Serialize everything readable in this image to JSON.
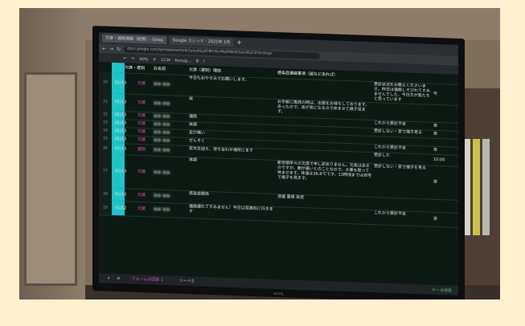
{
  "browser": {
    "tabs": [
      "文章・連絡連絡（総務）- Goog",
      "Google スレッド - 2021年 1月"
    ],
    "new_tab": "+",
    "url": "docs.google.com/spreadsheets/d/1unuA2yBTBYr8yrMqRNEdG5znXEiZ3FDn5hqV"
  },
  "toolbar": {
    "zoom": "90%",
    "currency": "¥",
    "format": "123▾",
    "font": "Kosug...",
    "bold": "B",
    "italic": "I"
  },
  "grid": {
    "header": {
      "col_c": "欠席・遅刻",
      "col_d": "お名前",
      "col_e": "欠席（遅刻）理由",
      "col_f": "感染症連絡事項（届などあれば）"
    },
    "rows": [
      {
        "num": "20",
        "date": "01/13",
        "status": "欠席",
        "reason": "今日もおやすみでお願いします。",
        "note": "",
        "reply": "受診状況をお教えくださいませ。昨日は連絡しそびれてすみませんでした。今日方が発たちと思っています",
        "col_h": "可"
      },
      {
        "num": "21",
        "date": "01/13",
        "status": "欠席",
        "reason": "咳",
        "note": "お手紙に風邪の時は、出席をお待ちしております。あったので、咳が気になるので休ませて様子見ます。",
        "reply": "",
        "col_h": ""
      },
      {
        "num": "22",
        "date": "01/13",
        "status": "欠席",
        "reason": "通院",
        "note": "",
        "reply": "これから受診予定",
        "col_h": "否"
      },
      {
        "num": "23",
        "date": "01/13",
        "status": "欠席",
        "reason": "体調",
        "note": "",
        "reply": "受診しない・家で様子見る",
        "col_h": "否"
      },
      {
        "num": "24",
        "date": "01/13",
        "status": "欠席",
        "reason": "足が痛い",
        "note": "",
        "reply": "",
        "col_h": ""
      },
      {
        "num": "25",
        "date": "01/13",
        "status": "欠席",
        "reason": "ぜんそく",
        "note": "",
        "reply": "これから受診予定",
        "col_h": "否"
      },
      {
        "num": "26",
        "date": "01/13",
        "status": "遅刻",
        "reason": "家先生迎え、待ち合わせ場所にます",
        "note": "",
        "reply": "受診した",
        "col_h": "10:00"
      },
      {
        "num": "27",
        "date": "01/13",
        "status": "欠席",
        "reason": "体調",
        "note": "新学期早々の欠席で申し訳ありません。元気はあるのですが、朝が痛いとのことなので、大事を取って休ませます。体温は36.8℃です。13時頃までは自宅で様子を見ます。",
        "reply": "受診しない・家で様子を見る",
        "col_h": "否"
      },
      {
        "num": "28",
        "date": "01/13",
        "status": "欠席",
        "reason": "感染症関係",
        "note": "溶連 菌感 染症",
        "reply": "",
        "col_h": ""
      },
      {
        "num": "29",
        "date": "01/12",
        "status": "欠席",
        "reason": "連絡遅れてすみません！今日は耳鼻科に行きます",
        "note": "",
        "reply": "これから受診予定",
        "col_h": "否"
      }
    ]
  },
  "bottombar": {
    "add": "+",
    "menu": "≡",
    "sheet1": "フォームの回答 1",
    "sheet2": "シート2",
    "explore": "データ探索"
  },
  "monitor": {
    "brand": "VESTEL"
  },
  "colors": {
    "status_pink": "#ff4fc8",
    "highlight_cyan": "#20c4c8",
    "sheet_bg": "#0d1913"
  }
}
